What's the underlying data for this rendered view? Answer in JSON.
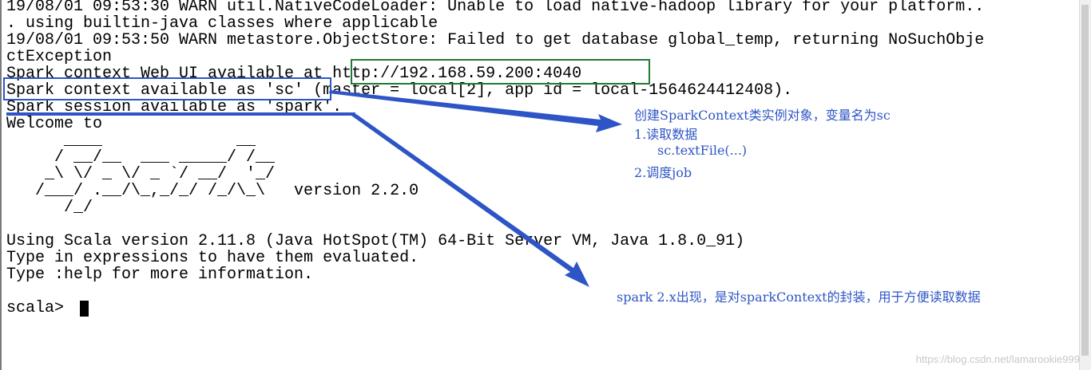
{
  "terminal": {
    "lines": [
      "19/08/01 09:53:30 WARN util.NativeCodeLoader: Unable to load native-hadoop library for your platform..",
      ". using builtin-java classes where applicable",
      "19/08/01 09:53:50 WARN metastore.ObjectStore: Failed to get database global_temp, returning NoSuchObje",
      "ctException",
      "Spark context Web UI available at http://192.168.59.200:4040",
      "Spark context available as 'sc' (master = local[2], app id = local-1564624412408).",
      "Spark session available as 'spark'.",
      "Welcome to",
      "      ____              __",
      "     / __/__  ___ _____/ /__",
      "    _\\ \\/ _ \\/ _ `/ __/  '_/",
      "   /___/ .__/\\_,_/_/ /_/\\_\\   version 2.2.0",
      "      /_/",
      "",
      "Using Scala version 2.11.8 (Java HotSpot(TM) 64-Bit Server VM, Java 1.8.0_91)",
      "Type in expressions to have them evaluated.",
      "Type :help for more information.",
      "",
      "scala> "
    ]
  },
  "annotations": {
    "sc_note_title": "创建SparkContext类实例对象，变量名为sc",
    "sc_note_item1": "1.读取数据",
    "sc_note_item1_sub": "sc.textFile(...)",
    "sc_note_item2": "2.调度job",
    "spark_note": "spark 2.x出现，是对sparkContext的封装，用于方便读取数据",
    "colors": {
      "annotation_blue": "#2e55c6",
      "url_box_green": "#1f7a35"
    }
  },
  "watermark": "https://blog.csdn.net/lamarookie999"
}
